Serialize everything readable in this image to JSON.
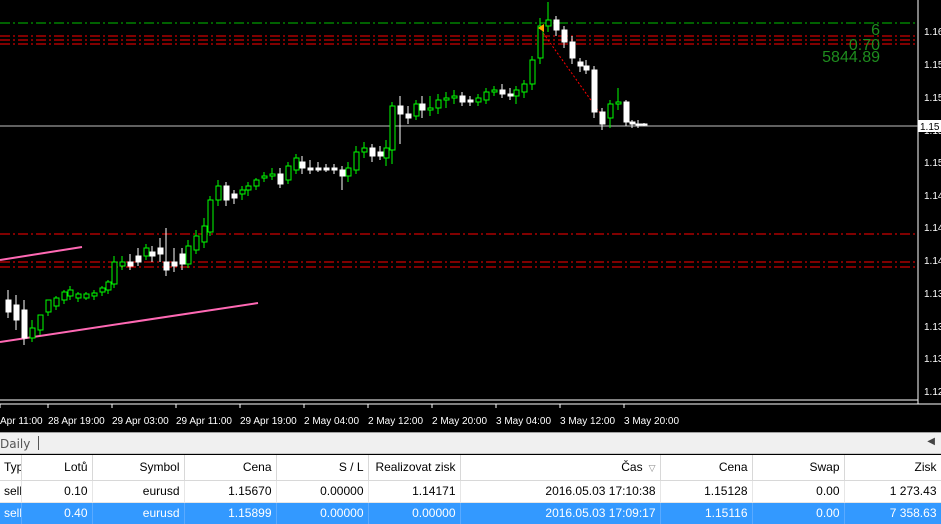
{
  "chart": {
    "price_labels": [
      "1.16",
      "1.15",
      "1.15",
      "1.15",
      "1.15",
      "1.14",
      "1.14",
      "1.14",
      "1.13",
      "1.13",
      "1.13",
      "1.12"
    ],
    "current_price_tag": "1.15",
    "time_labels": [
      "Apr 11:00",
      "28 Apr 19:00",
      "29 Apr 03:00",
      "29 Apr 11:00",
      "29 Apr 19:00",
      "2 May 04:00",
      "2 May 12:00",
      "2 May 20:00",
      "3 May 04:00",
      "3 May 12:00",
      "3 May 20:00"
    ],
    "overlay": {
      "line1": "6",
      "line2": "0.70",
      "line3": "5844.89"
    },
    "colors": {
      "bull": "#00ff00",
      "bear": "#ffffff",
      "grid_line": "#ff0000",
      "trend": "#ff69b4",
      "overlay": "#1e8c1e"
    }
  },
  "tab": {
    "label": "Daily"
  },
  "table": {
    "columns": [
      "Typ",
      "Lotů",
      "Symbol",
      "Cena",
      "S / L",
      "Realizovat zisk",
      "Čas",
      "Cena",
      "Swap",
      "Zisk"
    ],
    "rows": [
      {
        "typ": "sell",
        "lotu": "0.10",
        "symbol": "eurusd",
        "cena": "1.15670",
        "sl": "0.00000",
        "tp": "1.14171",
        "cas": "2016.05.03 17:10:38",
        "cena2": "1.15128",
        "swap": "0.00",
        "zisk": "1 273.43",
        "selected": false
      },
      {
        "typ": "sell",
        "lotu": "0.40",
        "symbol": "eurusd",
        "cena": "1.15899",
        "sl": "0.00000",
        "tp": "0.00000",
        "cas": "2016.05.03 17:09:17",
        "cena2": "1.15116",
        "swap": "0.00",
        "zisk": "7 358.63",
        "selected": true
      }
    ]
  }
}
